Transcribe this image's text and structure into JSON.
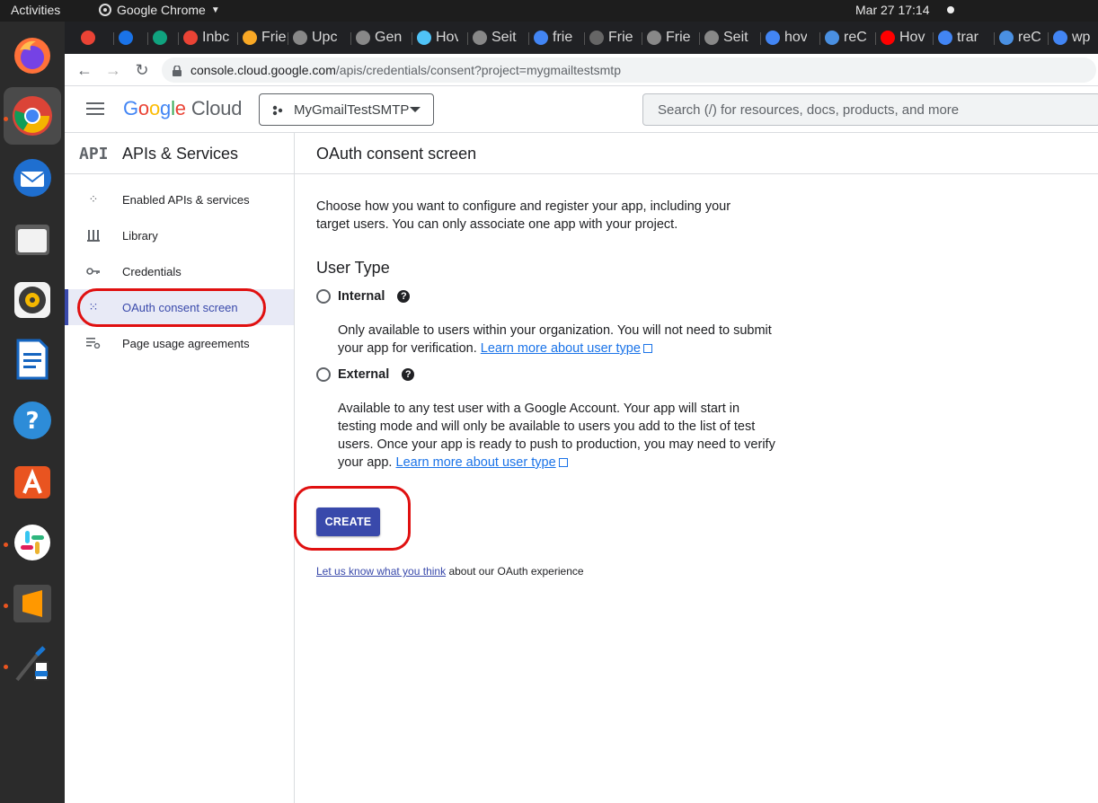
{
  "system": {
    "activities": "Activities",
    "app_name": "Google Chrome",
    "clock": "Mar 27  17:14"
  },
  "tabs": [
    {
      "label": "",
      "icon": "gmail-icon",
      "color": "#ea4335"
    },
    {
      "label": "",
      "icon": "circle-app-icon",
      "color": "#1a73e8"
    },
    {
      "label": "",
      "icon": "chatgpt-icon",
      "color": "#10a37f"
    },
    {
      "label": "Inbc",
      "icon": "gmail-icon",
      "color": "#ea4335"
    },
    {
      "label": "Frie",
      "icon": "bookmark-icon",
      "color": "#f9a825"
    },
    {
      "label": "Upc",
      "icon": "stackoverflow-icon",
      "color": "#888888"
    },
    {
      "label": "Gen",
      "icon": "stackoverflow-icon",
      "color": "#888888"
    },
    {
      "label": "Hov",
      "icon": "drop-icon",
      "color": "#4fc3f7"
    },
    {
      "label": "Seit",
      "icon": "stackoverflow-icon",
      "color": "#888888"
    },
    {
      "label": "frie",
      "icon": "google-icon",
      "color": "#4285f4"
    },
    {
      "label": "Frie",
      "icon": "wordpress-icon",
      "color": "#666666"
    },
    {
      "label": "Frie",
      "icon": "stackoverflow-icon",
      "color": "#888888"
    },
    {
      "label": "Seit",
      "icon": "stackoverflow-icon",
      "color": "#888888"
    },
    {
      "label": "hov",
      "icon": "google-icon",
      "color": "#4285f4"
    },
    {
      "label": "reC",
      "icon": "recaptcha-icon",
      "color": "#4a90e2"
    },
    {
      "label": "Hov",
      "icon": "youtube-icon",
      "color": "#ff0000"
    },
    {
      "label": "trar",
      "icon": "google-icon",
      "color": "#4285f4"
    },
    {
      "label": "reC",
      "icon": "recaptcha-icon",
      "color": "#4a90e2"
    },
    {
      "label": "wp",
      "icon": "google-icon",
      "color": "#4285f4"
    }
  ],
  "address": {
    "host": "console.cloud.google.com",
    "path": "/apis/credentials/consent?project=mygmailtestsmtp"
  },
  "header": {
    "logo_google": [
      "G",
      "o",
      "o",
      "g",
      "l",
      "e"
    ],
    "logo_cloud": "Cloud",
    "project": "MyGmailTestSMTP",
    "search_placeholder": "Search (/) for resources, docs, products, and more"
  },
  "sidebar": {
    "badge": "API",
    "title": "APIs & Services",
    "items": [
      {
        "label": "Enabled APIs & services",
        "icon": "diamond-dots-icon"
      },
      {
        "label": "Library",
        "icon": "library-icon"
      },
      {
        "label": "Credentials",
        "icon": "key-icon"
      },
      {
        "label": "OAuth consent screen",
        "icon": "consent-grid-icon"
      },
      {
        "label": "Page usage agreements",
        "icon": "list-settings-icon"
      }
    ]
  },
  "main": {
    "title": "OAuth consent screen",
    "intro": "Choose how you want to configure and register your app, including your target users. You can only associate one app with your project.",
    "user_type_title": "User Type",
    "internal": {
      "label": "Internal",
      "desc": "Only available to users within your organization. You will not need to submit your app for verification.",
      "link": "Learn more about user type"
    },
    "external": {
      "label": "External",
      "desc": "Available to any test user with a Google Account. Your app will start in testing mode and will only be available to users you add to the list of test users. Once your app is ready to push to production, you may need to verify your app.",
      "link": "Learn more about user type"
    },
    "create": "CREATE",
    "feedback_link": "Let us know what you think",
    "feedback_rest": "about our OAuth experience"
  }
}
